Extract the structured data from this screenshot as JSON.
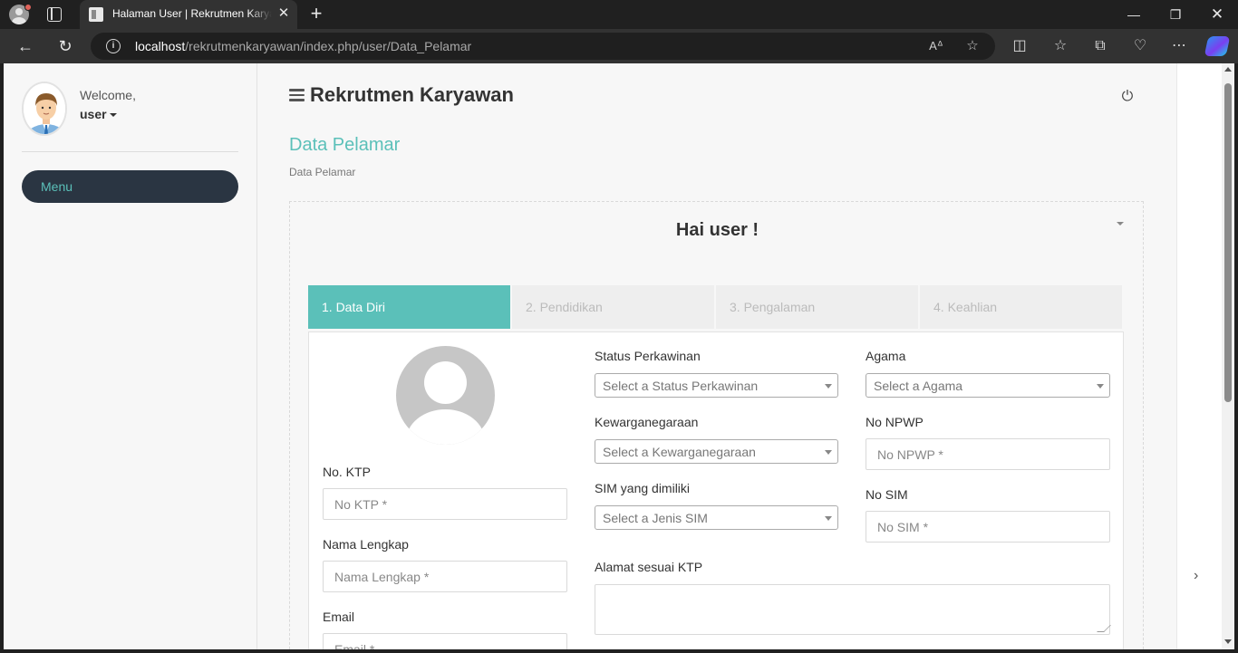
{
  "browser": {
    "tab_title": "Halaman User | Rekrutmen Karyawan",
    "url_host": "localhost",
    "url_path": "/rekrutmenkaryawan/index.php/user/Data_Pelamar"
  },
  "sidebar": {
    "welcome": "Welcome,",
    "username": "user",
    "menu_label": "Menu"
  },
  "header": {
    "app_title": "Rekrutmen Karyawan"
  },
  "page": {
    "title": "Data Pelamar",
    "breadcrumb": "Data Pelamar",
    "greeting": "Hai user !"
  },
  "steps": [
    {
      "label": "1. Data Diri",
      "active": true
    },
    {
      "label": "2. Pendidikan",
      "active": false
    },
    {
      "label": "3. Pengalaman",
      "active": false
    },
    {
      "label": "4. Keahlian",
      "active": false
    }
  ],
  "form": {
    "ktp": {
      "label": "No. KTP",
      "placeholder": "No KTP *"
    },
    "nama": {
      "label": "Nama Lengkap",
      "placeholder": "Nama Lengkap *"
    },
    "email": {
      "label": "Email",
      "placeholder": "Email *"
    },
    "status": {
      "label": "Status Perkawinan",
      "placeholder": "Select a Status Perkawinan"
    },
    "kewarganegaraan": {
      "label": "Kewarganegaraan",
      "placeholder": "Select a Kewarganegaraan"
    },
    "sim_type": {
      "label": "SIM yang dimiliki",
      "placeholder": "Select a Jenis SIM"
    },
    "agama": {
      "label": "Agama",
      "placeholder": "Select a Agama"
    },
    "npwp": {
      "label": "No NPWP",
      "placeholder": "No NPWP *"
    },
    "sim_no": {
      "label": "No SIM",
      "placeholder": "No SIM *"
    },
    "alamat": {
      "label": "Alamat sesuai KTP"
    }
  },
  "icons": {
    "accent": "#5bc0b9",
    "sidebar_menu_bg": "#2a3542"
  }
}
